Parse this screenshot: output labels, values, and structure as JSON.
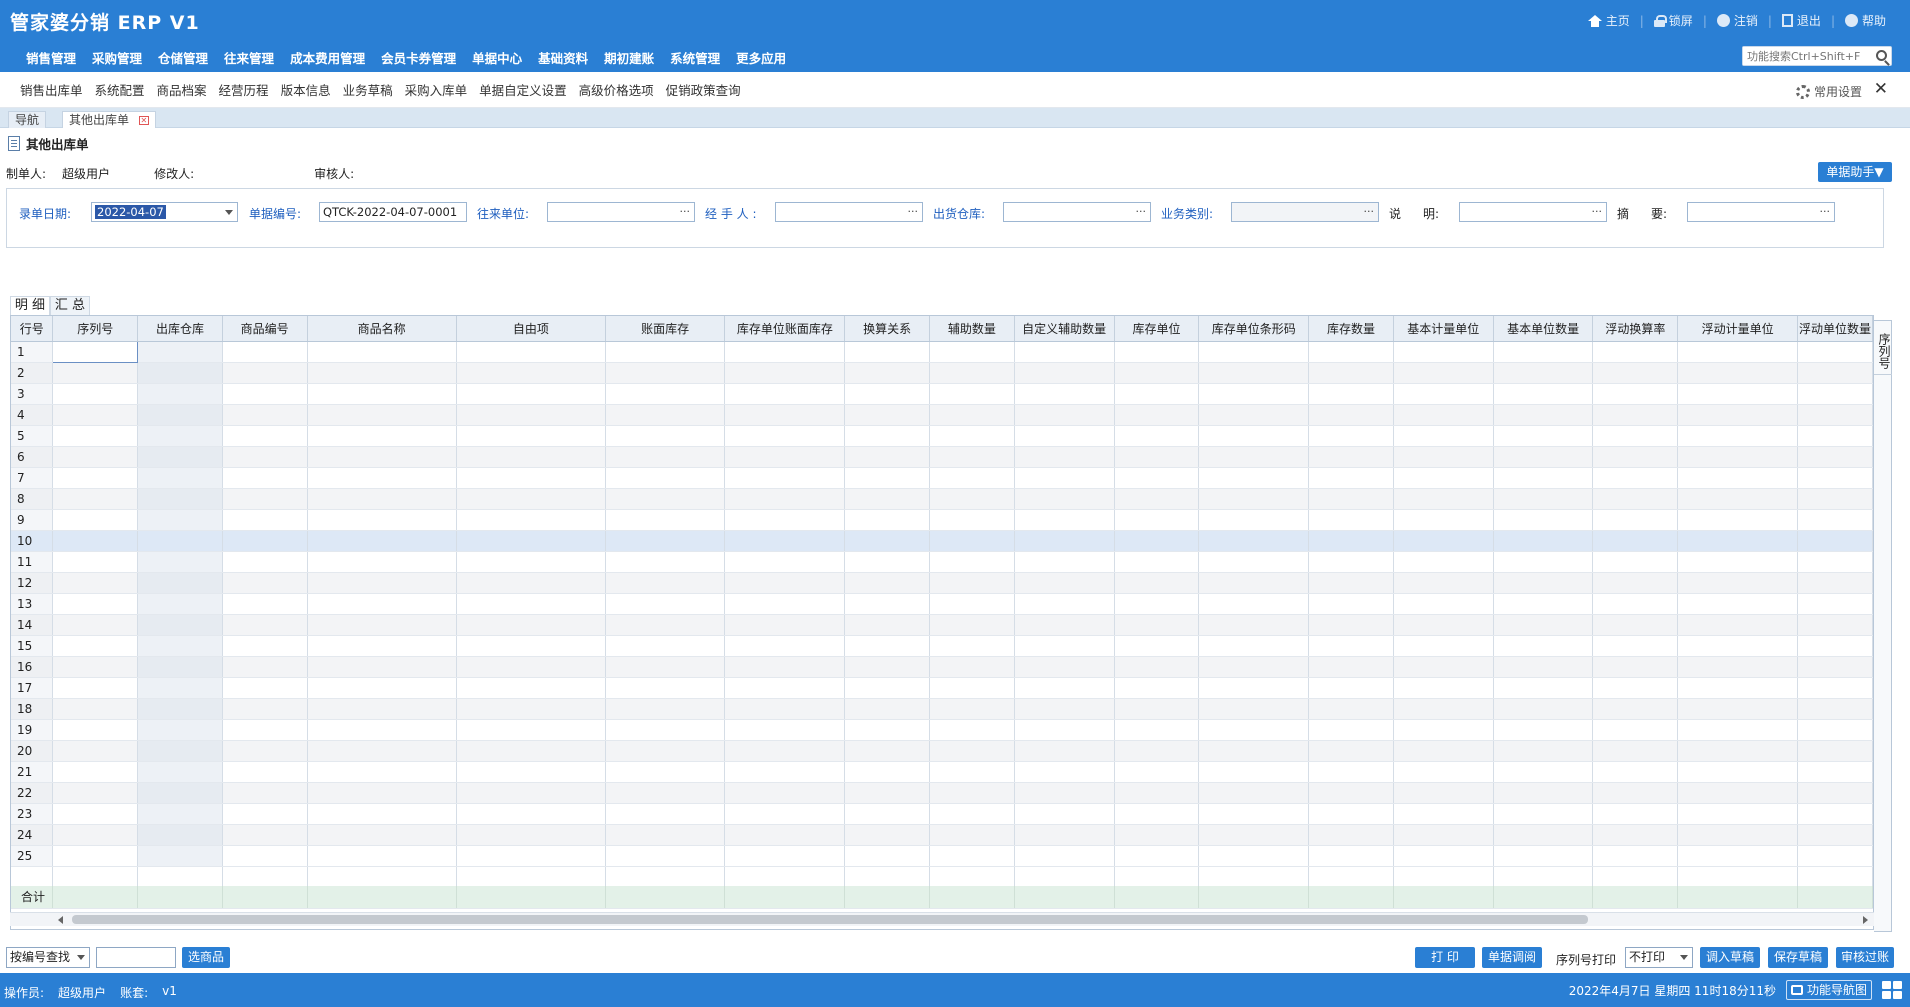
{
  "app": {
    "title": "管家婆分销 ERP V1"
  },
  "top_links": [
    {
      "icon": "home-icon",
      "label": "主页"
    },
    {
      "icon": "lock-icon",
      "label": "锁屏"
    },
    {
      "icon": "power-icon",
      "label": "注销"
    },
    {
      "icon": "exit-icon",
      "label": "退出"
    },
    {
      "icon": "help-icon",
      "label": "帮助"
    }
  ],
  "main_nav": [
    "销售管理",
    "采购管理",
    "仓储管理",
    "往来管理",
    "成本费用管理",
    "会员卡券管理",
    "单据中心",
    "基础资料",
    "期初建账",
    "系统管理",
    "更多应用"
  ],
  "search": {
    "placeholder": "功能搜索Ctrl+Shift+F"
  },
  "quick_links": [
    "销售出库单",
    "系统配置",
    "商品档案",
    "经营历程",
    "版本信息",
    "业务草稿",
    "采购入库单",
    "单据自定义设置",
    "高级价格选项",
    "促销政策查询"
  ],
  "settings_label": "常用设置",
  "tabs": [
    {
      "label": "导航"
    },
    {
      "label": "其他出库单"
    }
  ],
  "doc": {
    "title": "其他出库单",
    "maker_label": "制单人:",
    "maker_value": "超级用户",
    "modifier_label": "修改人:",
    "modifier_value": "",
    "auditor_label": "审核人:",
    "auditor_value": "",
    "assist_button": "单据助手▼"
  },
  "form": {
    "date_label": "录单日期:",
    "date_value": "2022-04-07",
    "no_label": "单据编号:",
    "no_value": "QTCK-2022-04-07-0001",
    "partner_label": "往来单位:",
    "handler_label": "经 手 人 :",
    "warehouse_label": "出货仓库:",
    "biztype_label": "业务类别:",
    "desc_label": "说",
    "desc_label2": "明:",
    "summary_label": "摘",
    "summary_label2": "要:",
    "more": "···"
  },
  "sub_tabs": [
    "明 细",
    "汇 总"
  ],
  "grid": {
    "columns": [
      "行号",
      "序列号",
      "出库仓库",
      "商品编号",
      "商品名称",
      "自由项",
      "账面库存",
      "库存单位账面库存",
      "换算关系",
      "辅助数量",
      "自定义辅助数量",
      "库存单位",
      "库存单位条形码",
      "库存数量",
      "基本计量单位",
      "基本单位数量",
      "浮动换算率",
      "浮动计量单位",
      "浮动单位数量"
    ],
    "rows": [
      "1",
      "2",
      "3",
      "4",
      "5",
      "6",
      "7",
      "8",
      "9",
      "10",
      "11",
      "12",
      "13",
      "14",
      "15",
      "16",
      "17",
      "18",
      "19",
      "20",
      "21",
      "22",
      "23",
      "24",
      "25"
    ],
    "total_label": "合计",
    "side_label": "序列号"
  },
  "bottom": {
    "lookup_select": "按编号查找",
    "lookup_input": "",
    "pick_button": "选商品",
    "print_button": "打 印",
    "query_button": "单据调阅",
    "serial_print_label": "序列号打印",
    "serial_print_value": "不打印",
    "load_draft_button": "调入草稿",
    "save_draft_button": "保存草稿",
    "audit_button": "审核过账"
  },
  "status": {
    "operator_label": "操作员:",
    "operator_value": "超级用户",
    "account_label": "账套:",
    "account_value": "v1",
    "datetime": "2022年4月7日  星期四  11时18分11秒",
    "nav_map": "功能导航图"
  },
  "colors": {
    "primary": "#2a7fd4",
    "header_bg": "#2a7fd4",
    "label_blue": "#1f5fbf"
  }
}
